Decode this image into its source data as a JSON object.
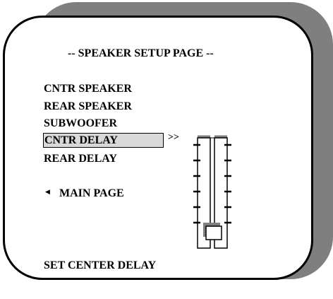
{
  "page": {
    "title": "-- SPEAKER SETUP PAGE --",
    "status_text": "SET CENTER DELAY"
  },
  "menu": {
    "items": [
      {
        "label": "CNTR SPEAKER"
      },
      {
        "label": "REAR SPEAKER"
      },
      {
        "label": "SUBWOOFER"
      },
      {
        "label": "CNTR DELAY",
        "selected": true
      },
      {
        "label": "REAR DELAY"
      }
    ],
    "selection_arrow": ">>",
    "main_page_label": "MAIN PAGE",
    "main_page_icon": "left-triangle-icon"
  },
  "slider": {
    "level_fraction": 0.0,
    "tick_count": 6
  },
  "colors": {
    "shadow": "#7f7f7f",
    "selection_fill": "#d9d9d9",
    "slider_top_accent": "#7f7f7f"
  }
}
